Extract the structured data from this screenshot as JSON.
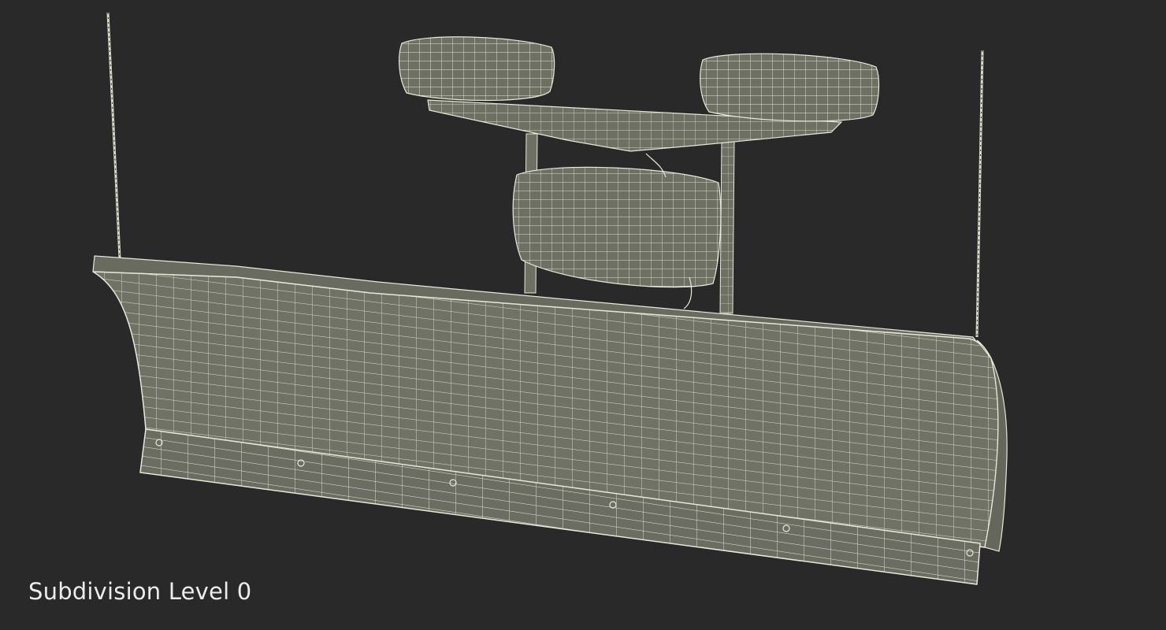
{
  "caption": "Subdivision Level 0",
  "colors": {
    "background": "#292929",
    "surface": "#6f7064",
    "surface_dark": "#5f6056",
    "wire": "#e9e8d8",
    "caption_text": "#ececec"
  },
  "model_parts": [
    "left-marker-rod",
    "right-marker-rod",
    "left-headlight",
    "right-headlight",
    "light-bar",
    "hydraulic-unit",
    "plow-blade",
    "cutting-edge",
    "top-rail",
    "mount-frame"
  ]
}
